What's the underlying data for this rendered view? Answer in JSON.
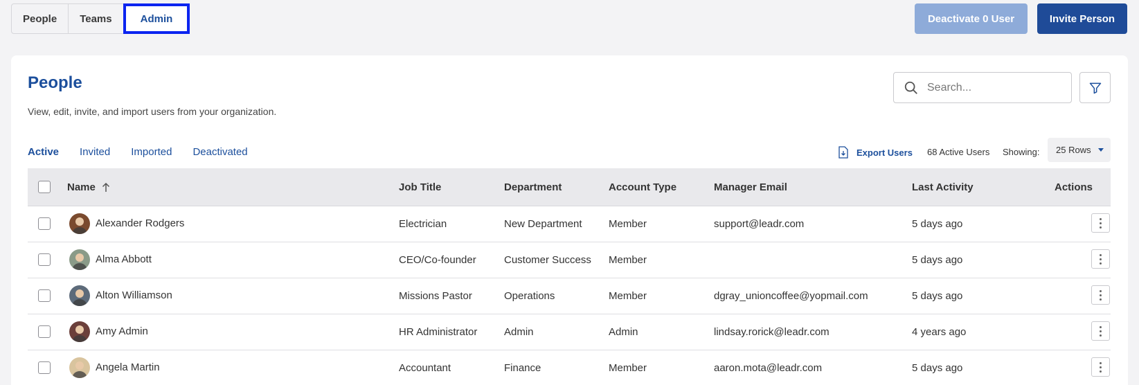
{
  "top_tabs": [
    "People",
    "Teams",
    "Admin"
  ],
  "buttons": {
    "deactivate": "Deactivate 0 User",
    "invite": "Invite Person"
  },
  "card": {
    "title": "People",
    "subtitle": "View, edit, invite, and import users from your organization.",
    "search_placeholder": "Search..."
  },
  "sub_tabs": [
    "Active",
    "Invited",
    "Imported",
    "Deactivated"
  ],
  "toolbar": {
    "export_label": "Export Users",
    "active_count": "68 Active Users",
    "showing_label": "Showing:",
    "rows_value": "25 Rows"
  },
  "columns": {
    "name": "Name",
    "job_title": "Job Title",
    "department": "Department",
    "account_type": "Account Type",
    "manager_email": "Manager Email",
    "last_activity": "Last Activity",
    "actions": "Actions"
  },
  "rows": [
    {
      "name": "Alexander Rodgers",
      "job_title": "Electrician",
      "department": "New Department",
      "account_type": "Member",
      "manager_email": "support@leadr.com",
      "last_activity": "5 days ago",
      "avatar_color": "#7a4a2e"
    },
    {
      "name": "Alma Abbott",
      "job_title": "CEO/Co-founder",
      "department": "Customer Success",
      "account_type": "Member",
      "manager_email": "",
      "last_activity": "5 days ago",
      "avatar_color": "#8a9b88"
    },
    {
      "name": "Alton Williamson",
      "job_title": "Missions Pastor",
      "department": "Operations",
      "account_type": "Member",
      "manager_email": "dgray_unioncoffee@yopmail.com",
      "last_activity": "5 days ago",
      "avatar_color": "#5d6b7a"
    },
    {
      "name": "Amy Admin",
      "job_title": "HR Administrator",
      "department": "Admin",
      "account_type": "Admin",
      "manager_email": "lindsay.rorick@leadr.com",
      "last_activity": "4 years ago",
      "avatar_color": "#6b3f3a"
    },
    {
      "name": "Angela Martin",
      "job_title": "Accountant",
      "department": "Finance",
      "account_type": "Member",
      "manager_email": "aaron.mota@leadr.com",
      "last_activity": "5 days ago",
      "avatar_color": "#d9c49e"
    }
  ]
}
